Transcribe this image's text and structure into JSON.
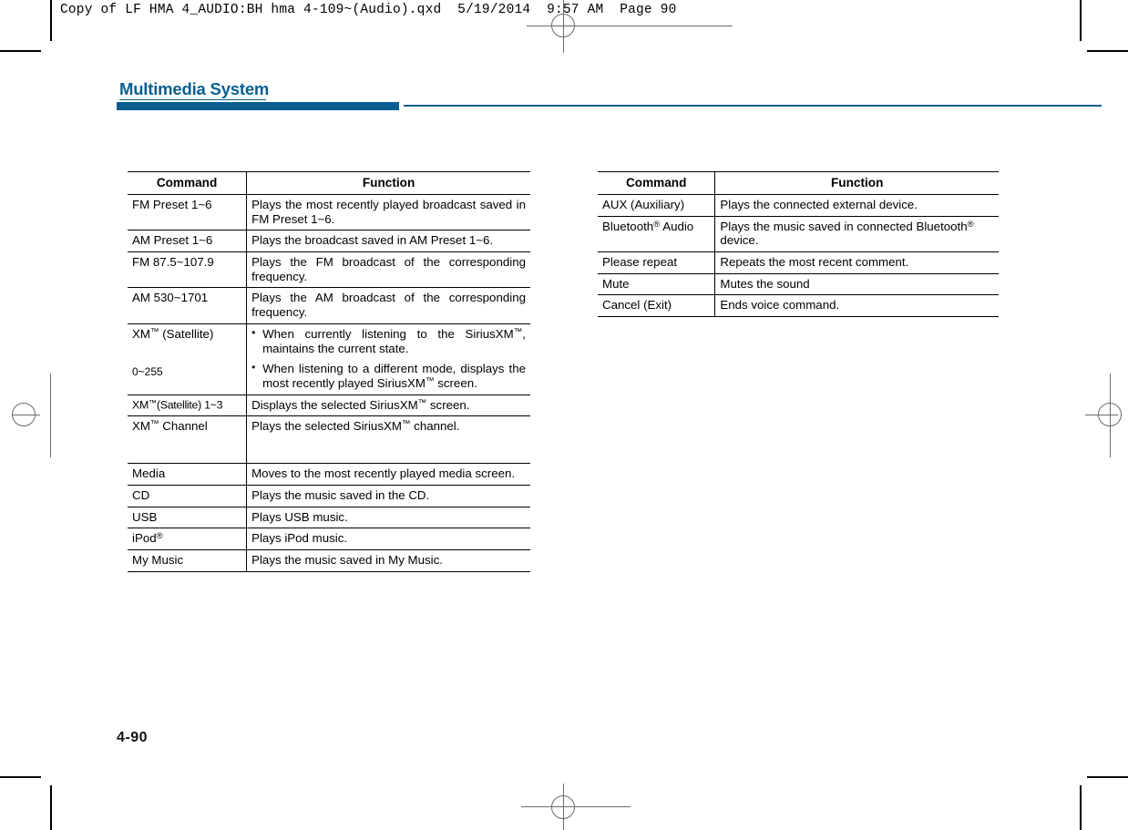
{
  "slug": "Copy of LF HMA 4_AUDIO:BH hma 4-109~(Audio).qxd  5/19/2014  9:57 AM  Page 90",
  "header": {
    "section_title": "Multimedia System",
    "accent_color": "#0a5e90"
  },
  "footer": {
    "page_number": "4-90"
  },
  "tables": {
    "left": {
      "headers": {
        "command": "Command",
        "function": "Function"
      },
      "rows": [
        {
          "command": "FM Preset 1~6",
          "function": "Plays the most recently played broadcast saved in FM Preset 1~6."
        },
        {
          "command": "AM Preset 1~6",
          "function": "Plays the broadcast saved in AM Preset 1~6."
        },
        {
          "command": "FM 87.5~107.9",
          "function": "Plays the FM broadcast of the corresponding frequency."
        },
        {
          "command": "AM 530~1701",
          "function": "Plays the AM broadcast of the corresponding frequency."
        },
        {
          "command_top": "XM™ (Satellite)",
          "command_bottom": "0~255",
          "bullets": [
            "When currently listening to the SiriusXM™, maintains the current state.",
            "When listening to a different mode, displays the most recently played SiriusXM™ screen."
          ]
        },
        {
          "command": "XM™(Satellite) 1~3",
          "function": "Displays the selected SiriusXM™ screen."
        },
        {
          "command": "XM™ Channel",
          "function": "Plays the selected SiriusXM™ channel."
        },
        {
          "command": "Media",
          "function": "Moves to the most recently played media screen."
        },
        {
          "command": "CD",
          "function": "Plays the music saved in the CD."
        },
        {
          "command": "USB",
          "function": "Plays USB music."
        },
        {
          "command": "iPod®",
          "function": "Plays iPod music."
        },
        {
          "command": "My Music",
          "function": "Plays the music saved in My Music."
        }
      ]
    },
    "right": {
      "headers": {
        "command": "Command",
        "function": "Function"
      },
      "rows": [
        {
          "command": "AUX (Auxiliary)",
          "function": "Plays the connected external device."
        },
        {
          "command": "Bluetooth® Audio",
          "function": "Plays the music saved in connected Bluetooth® device."
        },
        {
          "command": "Please repeat",
          "function": "Repeats the most recent comment."
        },
        {
          "command": "Mute",
          "function": "Mutes the sound"
        },
        {
          "command": "Cancel (Exit)",
          "function": "Ends voice command."
        }
      ]
    }
  }
}
